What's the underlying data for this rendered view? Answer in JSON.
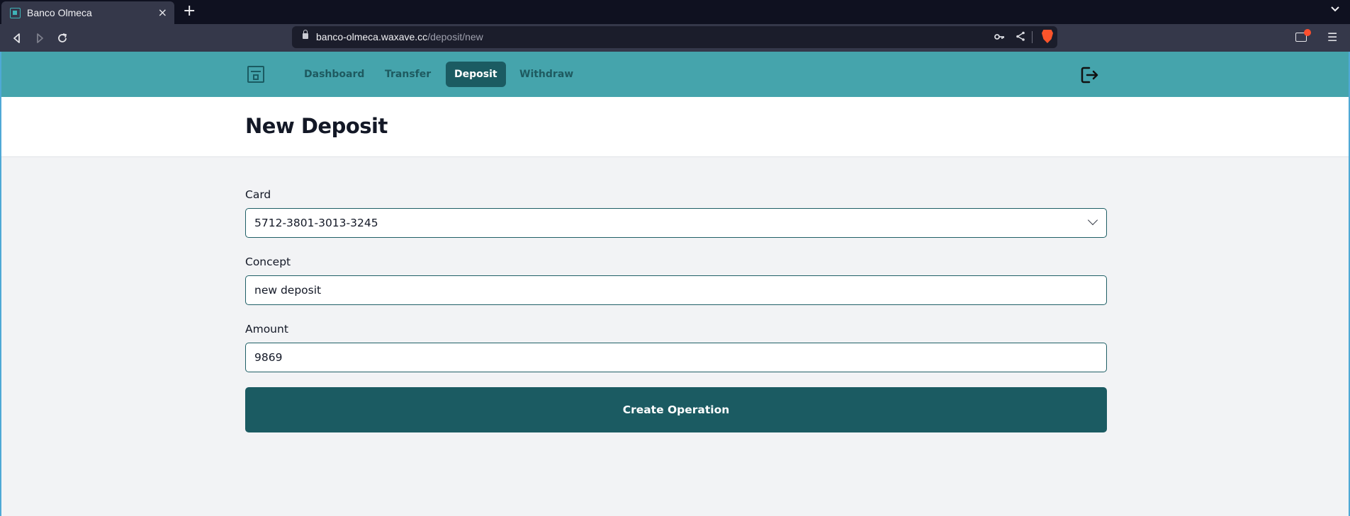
{
  "browser": {
    "tab_title": "Banco Olmeca",
    "tab_close": "×",
    "new_tab": "+",
    "tabs_menu": "⌄",
    "url_domain": "banco-olmeca.waxave.cc",
    "url_path": "/deposit/new",
    "menu": "☰"
  },
  "nav": {
    "links": [
      "Dashboard",
      "Transfer",
      "Deposit",
      "Withdraw"
    ],
    "active": "Deposit"
  },
  "page": {
    "title": "New Deposit"
  },
  "form": {
    "card_label": "Card",
    "card_value": "5712-3801-3013-3245",
    "concept_label": "Concept",
    "concept_value": "new deposit",
    "amount_label": "Amount",
    "amount_value": "9869",
    "submit_label": "Create Operation"
  },
  "colors": {
    "navbar": "#45a4ac",
    "primary": "#1b5b62",
    "background": "#f2f3f5"
  }
}
